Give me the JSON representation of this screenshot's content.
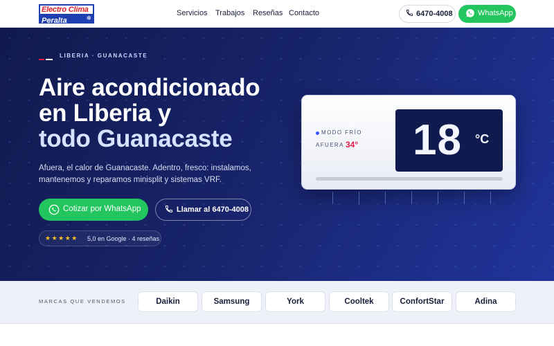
{
  "header": {
    "logo": {
      "line1": "Electro Clima",
      "line2": "Peralta"
    },
    "nav": [
      {
        "label": "Servicios"
      },
      {
        "label": "Trabajos"
      },
      {
        "label": "Reseñas"
      },
      {
        "label": "Contacto"
      }
    ],
    "phone_label": "6470-4008",
    "whatsapp_label": "WhatsApp"
  },
  "hero": {
    "eyebrow": "LIBERIA · GUANACASTE",
    "title_line1": "Aire acondicionado",
    "title_line2": "en Liberia y",
    "title_line3": "todo Guanacaste",
    "subtitle": "Afuera, el calor de Guanacaste. Adentro, fresco: instalamos, mantenemos y reparamos minisplit y sistemas VRF.",
    "cta_whatsapp": "Cotizar por WhatsApp",
    "cta_call": "Llamar al 6470-4008",
    "rating_stars": "★★★★★",
    "rating_text": "5,0 en Google · 4 reseñas"
  },
  "ac_unit": {
    "mode": "MODO FRÍO",
    "outside_label": "AFUERA",
    "outside_temp": "34°",
    "temperature": "18",
    "unit": "°C"
  },
  "brands": {
    "label": "MARCAS QUE VENDEMOS",
    "items": [
      "Daikin",
      "Samsung",
      "York",
      "Cooltek",
      "ConfortStar",
      "Adina"
    ]
  },
  "colors": {
    "accent_green": "#22c55e",
    "hero_navy": "#172368",
    "accent_red": "#e11d48",
    "logo_blue": "#1f3fb0"
  }
}
